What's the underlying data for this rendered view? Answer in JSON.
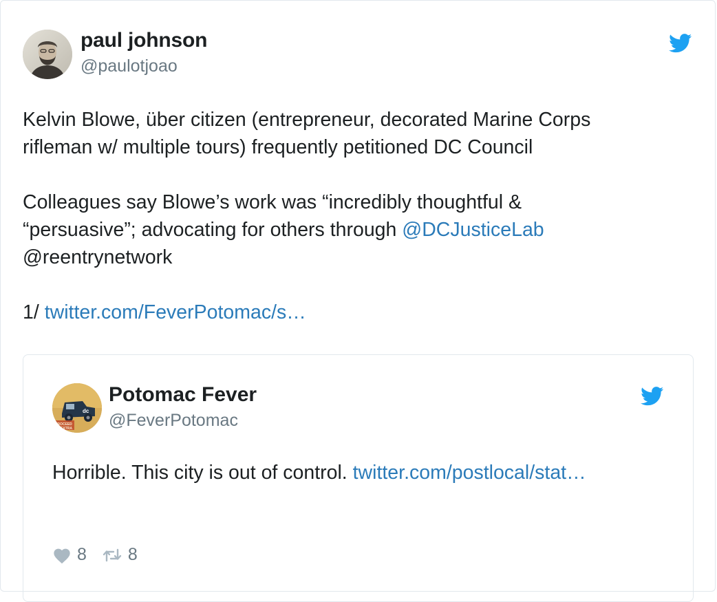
{
  "tweet": {
    "author_name": "paul johnson",
    "author_handle": "@paulotjoao",
    "logo_icon": "twitter-bird-icon",
    "paragraph1_line1": "Kelvin Blowe, über citizen (entrepreneur, decorated Marine Corps",
    "paragraph1_line2": "rifleman w/ multiple tours) frequently petitioned DC Council",
    "paragraph2_line1": "Colleagues say Blowe’s work was “incredibly thoughtful &",
    "paragraph2_line2_text": "“persuasive”; advocating for others through ",
    "paragraph2_line2_mention": "@DCJusticeLab",
    "paragraph2_line3": "@reentrynetwork",
    "paragraph3_prefix": "1/ ",
    "paragraph3_link": "twitter.com/FeverPotomac/s…"
  },
  "quoted_tweet": {
    "author_name": "Potomac Fever",
    "author_handle": "@FeverPotomac",
    "logo_icon": "twitter-bird-icon",
    "text": "Horrible. This city is out of control. ",
    "link": "twitter.com/postlocal/stat…",
    "likes_count": "8",
    "retweets_count": "8"
  },
  "colors": {
    "link": "#2b7bb9",
    "secondary_text": "#697882",
    "twitter_blue": "#1da1f2",
    "border": "#e1e8ed",
    "action_icon": "#aab8c2"
  }
}
